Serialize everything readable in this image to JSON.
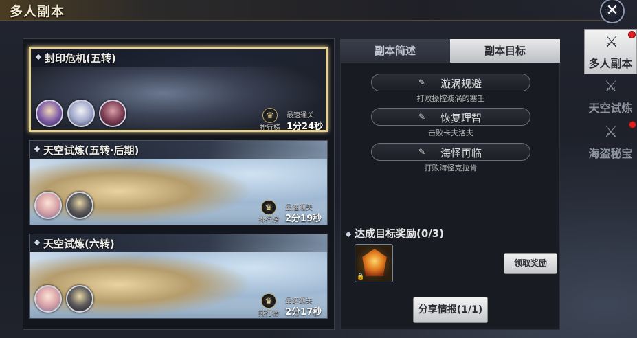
{
  "window": {
    "title": "多人副本"
  },
  "dungeons": [
    {
      "title": "封印危机(五转)",
      "rank_label": "排行榜",
      "best_label": "最速通关",
      "best_time": "1分24秒",
      "selected": true
    },
    {
      "title": "天空试炼(五转·后期)",
      "rank_label": "排行榜",
      "best_label": "最速通关",
      "best_time": "2分19秒",
      "selected": false
    },
    {
      "title": "天空试炼(六转)",
      "rank_label": "排行榜",
      "best_label": "最速通关",
      "best_time": "2分17秒",
      "selected": false
    }
  ],
  "tabs": [
    {
      "label": "副本简述",
      "active": false
    },
    {
      "label": "副本目标",
      "active": true
    }
  ],
  "goals": [
    {
      "name": "漩涡规避",
      "desc": "打败操控漩涡的塞壬"
    },
    {
      "name": "恢复理智",
      "desc": "击败卡夫洛夫"
    },
    {
      "name": "海怪再临",
      "desc": "打败海怪克拉肯"
    }
  ],
  "reward": {
    "heading": "达成目标奖励(0/3)",
    "claim_label": "领取奖励",
    "item_icon": "emblem-icon",
    "locked": true
  },
  "share": {
    "label": "分享情报(1/1)"
  },
  "side_nav": [
    {
      "label": "多人副本",
      "icon": "crossed-swords-icon",
      "active": true,
      "badge": true
    },
    {
      "label": "天空试炼",
      "icon": "crossed-swords-icon",
      "active": false,
      "badge": false
    },
    {
      "label": "海盗秘宝",
      "icon": "crossed-swords-icon",
      "active": false,
      "badge": true
    }
  ],
  "colors": {
    "accent_gold": "#e8d291",
    "badge_red": "#e02020",
    "panel_bg": "#191b23"
  }
}
